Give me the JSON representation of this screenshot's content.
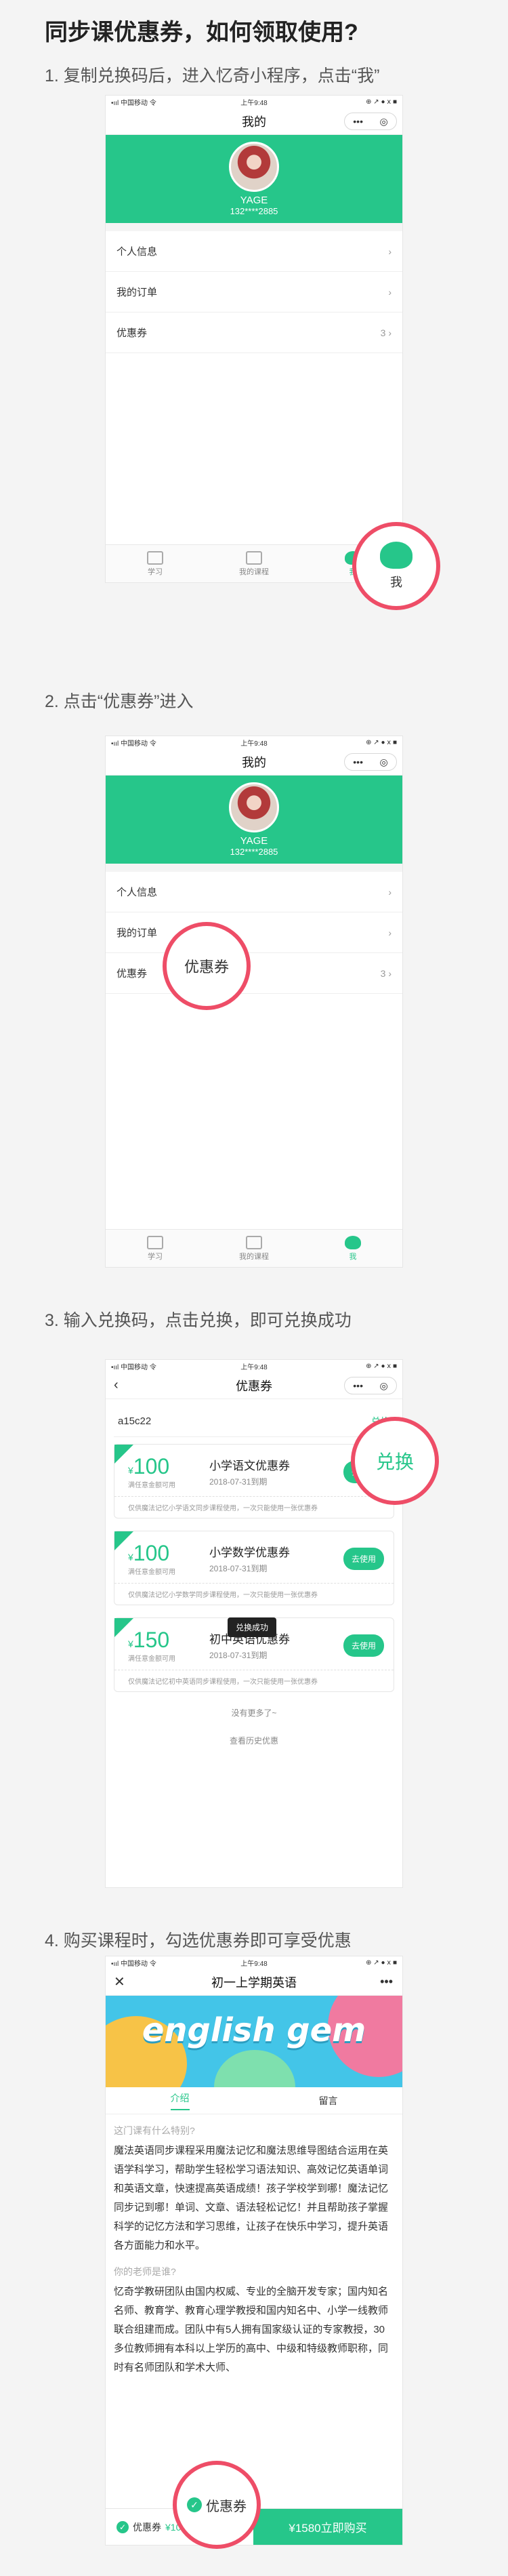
{
  "title": "同步课优惠券，如何领取使用?",
  "steps": [
    "1. 复制兑换码后，进入忆奇小程序，点击“我”",
    "2. 点击“优惠券”进入",
    "3. 输入兑换码，点击兑换，即可兑换成功",
    "4. 购买课程时，勾选优惠券即可享受优惠"
  ],
  "status": {
    "carrier": "•ııl 中国移动 令",
    "time": "上午9:48",
    "right": "⊕ ↗ ● ⅹ ■"
  },
  "me": {
    "nav_title": "我的",
    "capsule": [
      "•••",
      "◎"
    ],
    "user_name": "YAGE",
    "user_phone": "132****2885",
    "menu": [
      {
        "label": "个人信息",
        "value": ""
      },
      {
        "label": "我的订单",
        "value": ""
      },
      {
        "label": "优惠券",
        "value": "3"
      }
    ],
    "tabs": [
      "学习",
      "我的课程",
      "我"
    ]
  },
  "callouts": {
    "me": "我",
    "coupon": "优惠券",
    "redeem": "兑换",
    "select": "优惠券"
  },
  "coupons_page": {
    "nav_title": "优惠券",
    "code": "a15c22",
    "redeem_label": "兑换",
    "toast": "兑换成功",
    "coupons": [
      {
        "currency": "¥",
        "amount": "100",
        "cond": "满任意金额可用",
        "name": "小学语文优惠券",
        "expiry": "2018-07-31到期",
        "use": "去使用",
        "note": "仅供魔法记忆小学语文同步课程使用，一次只能使用一张优惠券"
      },
      {
        "currency": "¥",
        "amount": "100",
        "cond": "满任意金额可用",
        "name": "小学数学优惠券",
        "expiry": "2018-07-31到期",
        "use": "去使用",
        "note": "仅供魔法记忆小学数学同步课程使用，一次只能使用一张优惠券"
      },
      {
        "currency": "¥",
        "amount": "150",
        "cond": "满任意金额可用",
        "name": "初中英语优惠券",
        "expiry": "2018-07-31到期",
        "use": "去使用",
        "note": "仅供魔法记忆初中英语同步课程使用，一次只能使用一张优惠券"
      }
    ],
    "no_more": "没有更多了~",
    "history": "查看历史优惠"
  },
  "course_page": {
    "nav_title": "初一上学期英语",
    "banner_text": "english gem",
    "subtabs": [
      "介绍",
      "留言"
    ],
    "h1": "这门课有什么特别?",
    "p1": "魔法英语同步课程采用魔法记忆和魔法思维导图结合运用在英语学科学习，帮助学生轻松学习语法知识、高效记忆英语单词和英语文章，快速提高英语成绩！孩子学校学到哪！魔法记忆同步记到哪！单词、文章、语法轻松记忆！并且帮助孩子掌握科学的记忆方法和学习思维，让孩子在快乐中学习，提升英语各方面能力和水平。",
    "h2": "你的老师是谁?",
    "p2": "忆奇学教研团队由国内权威、专业的全脑开发专家；国内知名名师、教育学、教育心理学教授和国内知名中、小学一线教师联合组建而成。团队中有5人拥有国家级认证的专家教授，30多位教师拥有本科以上学历的高中、中级和特级教师职称，同时有名师团队和学术大师、",
    "buy_coupon_label": "优惠券",
    "buy_coupon_price": "¥100元",
    "buy_button": "¥1580立即购买",
    "colors": {
      "accent": "#26c68a",
      "callout": "#ee4d67"
    }
  }
}
